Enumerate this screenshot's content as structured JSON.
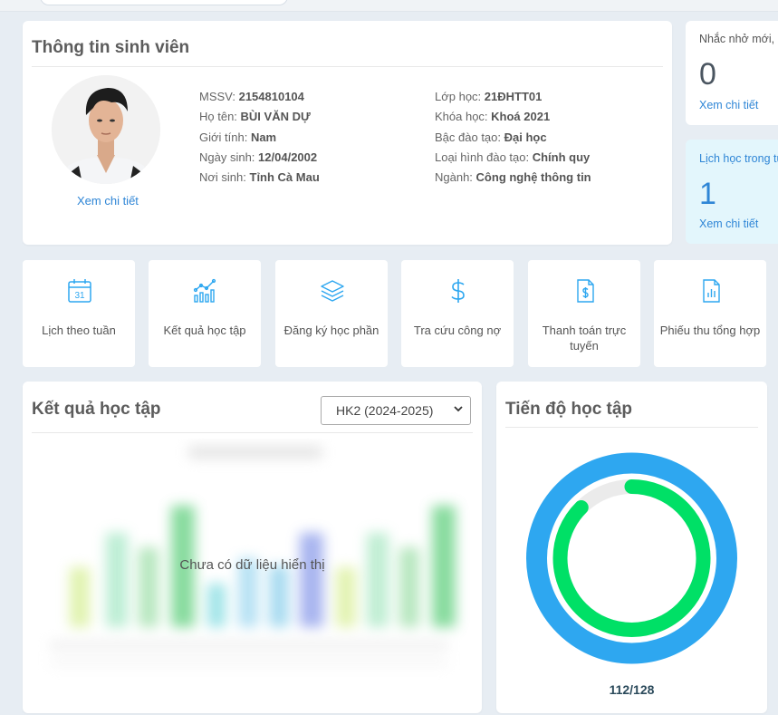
{
  "student": {
    "title": "Thông tin sinh viên",
    "view_detail": "Xem chi tiết",
    "left_fields": [
      {
        "label": "MSSV: ",
        "value": "2154810104"
      },
      {
        "label": "Họ tên: ",
        "value": "BÙI VĂN DỰ"
      },
      {
        "label": "Giới tính: ",
        "value": "Nam"
      },
      {
        "label": "Ngày sinh: ",
        "value": "12/04/2002"
      },
      {
        "label": "Nơi sinh: ",
        "value": "Tỉnh Cà Mau"
      }
    ],
    "right_fields": [
      {
        "label": "Lớp học: ",
        "value": "21ĐHTT01"
      },
      {
        "label": "Khóa học: ",
        "value": "Khoá 2021"
      },
      {
        "label": "Bậc đào tạo: ",
        "value": "Đại học"
      },
      {
        "label": "Loại hình đào tạo: ",
        "value": "Chính quy"
      },
      {
        "label": "Ngành: ",
        "value": "Công nghệ thông tin"
      }
    ]
  },
  "reminder": {
    "label": "Nhắc nhở mới, c",
    "count": "0",
    "link": "Xem chi tiết"
  },
  "schedule": {
    "label": "Lịch học trong tu",
    "count": "1",
    "link": "Xem chi tiết"
  },
  "tiles": [
    {
      "label": "Lịch theo tuần",
      "icon": "calendar-icon"
    },
    {
      "label": "Kết quả học tập",
      "icon": "bar-chart-icon"
    },
    {
      "label": "Đăng ký học phần",
      "icon": "layers-icon"
    },
    {
      "label": "Tra cứu công nợ",
      "icon": "dollar-icon"
    },
    {
      "label": "Thanh toán trực tuyến",
      "icon": "invoice-icon"
    },
    {
      "label": "Phiếu thu tổng hợp",
      "icon": "receipt-chart-icon"
    }
  ],
  "results": {
    "title": "Kết quả học tập",
    "semester": "HK2 (2024-2025)",
    "no_data": "Chưa có dữ liệu hiển thị",
    "calendar_day": "31"
  },
  "progress": {
    "title": "Tiến độ học tập",
    "value_text": "112/128",
    "completed": 112,
    "total": 128,
    "colors": {
      "outer": "#2ea7f0",
      "inner": "#00e066",
      "track": "#ebebeb"
    }
  },
  "colors": {
    "link": "#2f86d6",
    "accent_blue": "#2ea7f0",
    "schedule_bg": "#e3f6fc"
  }
}
